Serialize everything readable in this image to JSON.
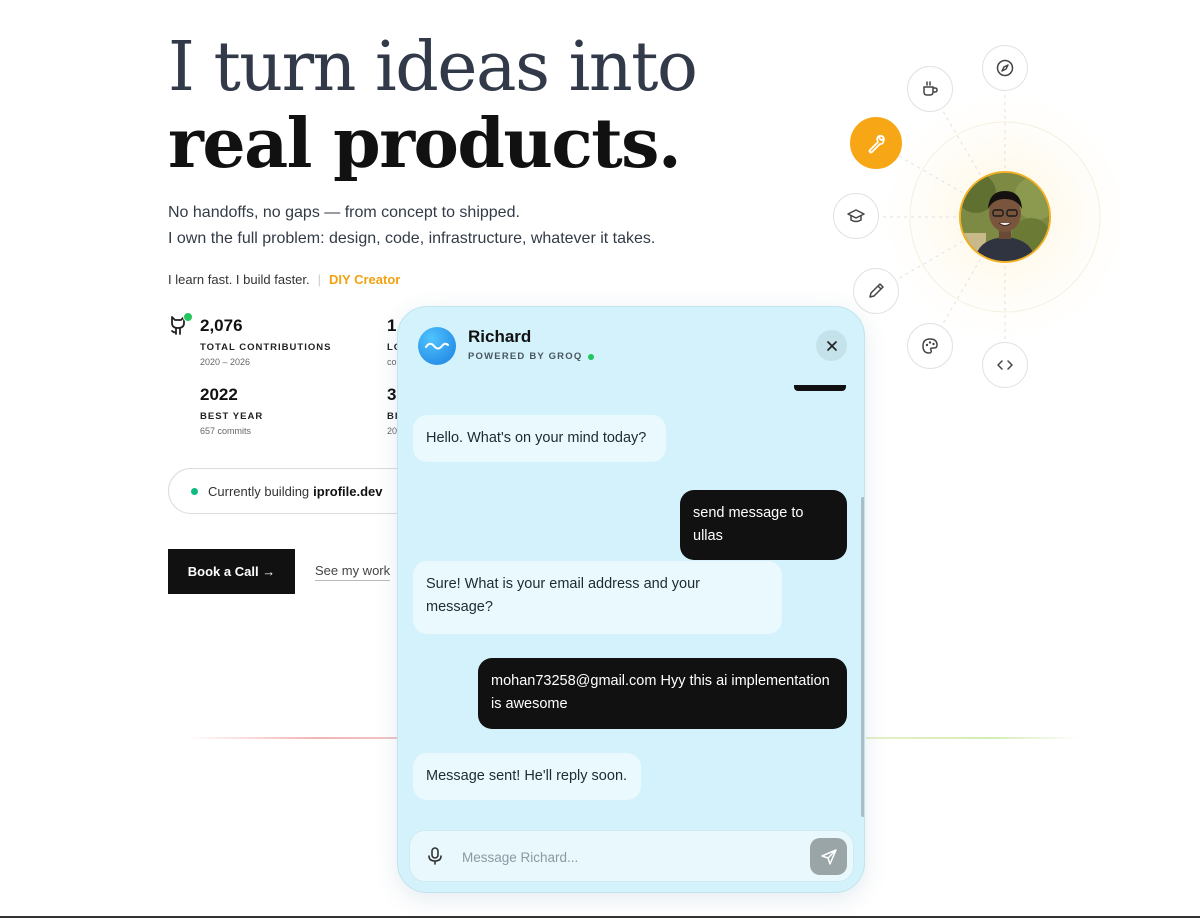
{
  "hero": {
    "line1": "I turn ideas into",
    "line2": "real products.",
    "tagline1": "No handoffs, no gaps — from concept to shipped.",
    "tagline2": "I own the full problem: design, code, infrastructure, whatever it takes.",
    "learn": "I learn fast. I build faster.",
    "separator": "|",
    "diy": "DIY Creator"
  },
  "stats": [
    {
      "num": "2,076",
      "label": "TOTAL CONTRIBUTIONS",
      "sub": "2020 – 2026"
    },
    {
      "num": "1",
      "label": "LO",
      "sub": "co"
    },
    {
      "num": "2022",
      "label": "BEST YEAR",
      "sub": "657 commits"
    },
    {
      "num": "3",
      "label": "BI",
      "sub": "20"
    }
  ],
  "building": {
    "prefix": "Currently building",
    "project": "iprofile.dev"
  },
  "actions": {
    "book": "Book a Call →",
    "see_work": "See my work"
  },
  "orbit": {
    "icons": [
      "coffee-icon",
      "compass-icon",
      "wrench-icon",
      "graduation-cap-icon",
      "pencil-icon",
      "palette-icon",
      "code-icon"
    ],
    "active": "wrench-icon",
    "accent": "#f7a716"
  },
  "chat": {
    "name": "Richard",
    "powered": "POWERED BY GROQ",
    "messages": [
      {
        "role": "bot",
        "text": "Hello. What's on your mind today?"
      },
      {
        "role": "user",
        "text": "send message to ullas"
      },
      {
        "role": "bot",
        "text": "Sure! What is your email address and your message?"
      },
      {
        "role": "user",
        "text": "mohan73258@gmail.com Hyy this ai implementation is awesome"
      },
      {
        "role": "bot",
        "text": "Message sent! He'll reply soon."
      }
    ],
    "placeholder": "Message Richard...",
    "bg": "#d3f2fb"
  }
}
